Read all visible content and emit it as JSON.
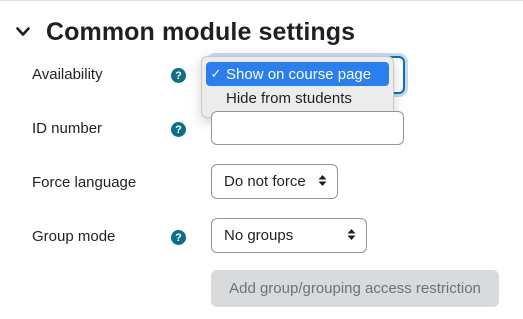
{
  "section": {
    "title": "Common module settings",
    "icon": "chevron-down-icon"
  },
  "fields": {
    "availability": {
      "label": "Availability",
      "options": [
        "Show on course page",
        "Hide from students"
      ],
      "selected": "Show on course page"
    },
    "id_number": {
      "label": "ID number",
      "value": ""
    },
    "force_language": {
      "label": "Force language",
      "value": "Do not force"
    },
    "group_mode": {
      "label": "Group mode",
      "value": "No groups"
    }
  },
  "buttons": {
    "add_restriction": "Add group/grouping access restriction"
  },
  "help_icon": "?",
  "check_mark": "✓",
  "colors": {
    "help_icon": "#0f6e84",
    "selected_option": "#2a7ef0",
    "focus_border": "#0f6cbf",
    "disabled_button": "#d8dadc"
  }
}
